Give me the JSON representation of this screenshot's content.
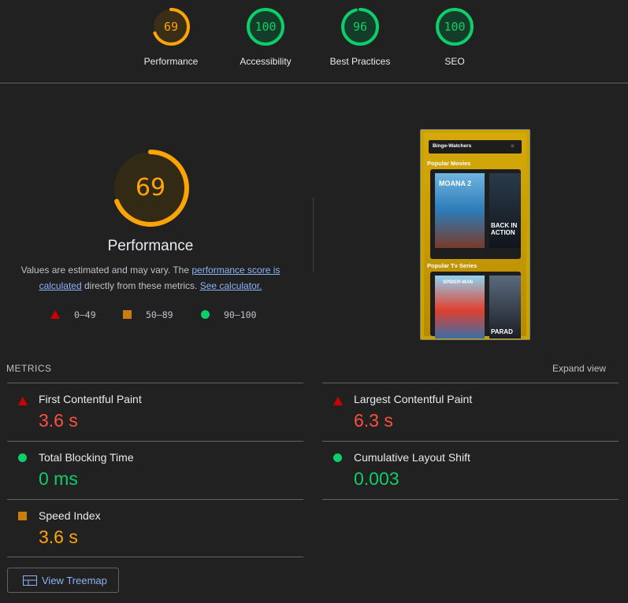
{
  "scores": [
    {
      "label": "Performance",
      "value": "69",
      "fraction": 0.69,
      "color": "#ffa400",
      "bg": "#3a2e16"
    },
    {
      "label": "Accessibility",
      "value": "100",
      "fraction": 1.0,
      "color": "#0cce6b",
      "bg": "#133d29"
    },
    {
      "label": "Best Practices",
      "value": "96",
      "fraction": 0.96,
      "color": "#0cce6b",
      "bg": "#133d29"
    },
    {
      "label": "SEO",
      "value": "100",
      "fraction": 1.0,
      "color": "#0cce6b",
      "bg": "#133d29"
    }
  ],
  "performance": {
    "score": "69",
    "fraction": 0.69,
    "title": "Performance",
    "desc_prefix": "Values are estimated and may vary. The ",
    "link1": "performance score is calculated",
    "desc_mid": " directly from these metrics. ",
    "link2": "See calculator."
  },
  "legend": {
    "fail": "0–49",
    "average": "50–89",
    "pass": "90–100"
  },
  "thumbnail": {
    "app_name": "Binge-Watchers",
    "section1": "Popular Movies",
    "section2": "Popular Tv Series",
    "poster1": "MOANA 2",
    "poster2": "BACK IN ACTION",
    "poster3": "SPIDER-MAN",
    "poster4": "PARAD"
  },
  "metrics": {
    "title": "METRICS",
    "expand": "Expand view",
    "items": [
      {
        "name": "First Contentful Paint",
        "value": "3.6 s",
        "status": "fail"
      },
      {
        "name": "Largest Contentful Paint",
        "value": "6.3 s",
        "status": "fail"
      },
      {
        "name": "Total Blocking Time",
        "value": "0 ms",
        "status": "pass"
      },
      {
        "name": "Cumulative Layout Shift",
        "value": "0.003",
        "status": "pass"
      },
      {
        "name": "Speed Index",
        "value": "3.6 s",
        "status": "average"
      }
    ]
  },
  "treemap_button": "View Treemap"
}
